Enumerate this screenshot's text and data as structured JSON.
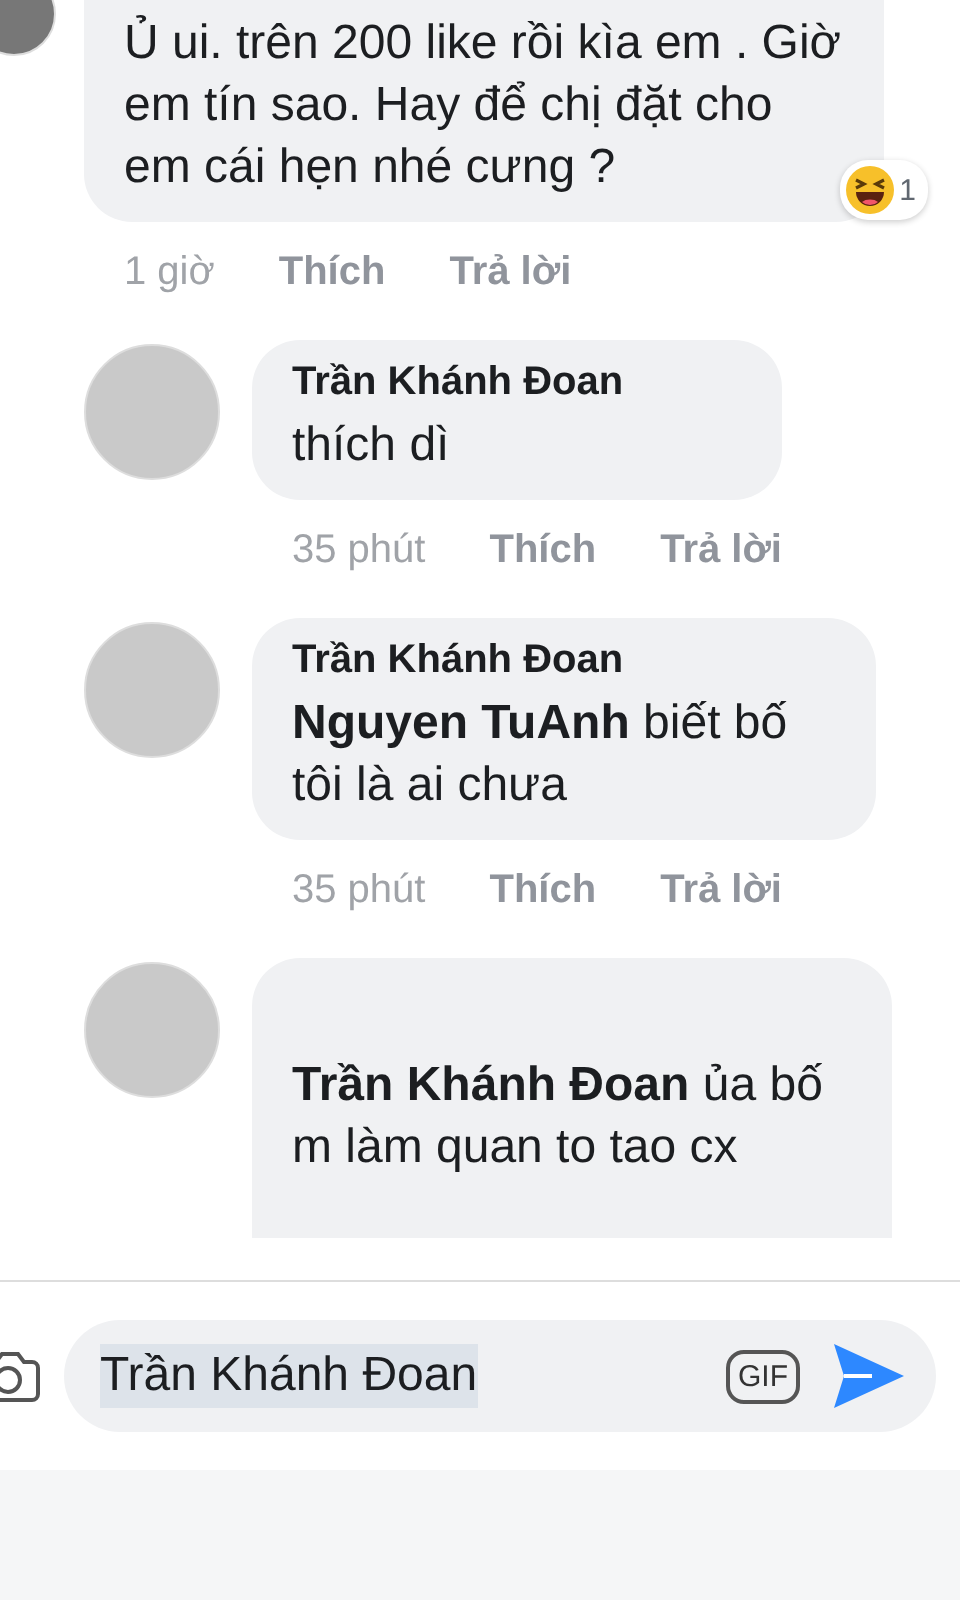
{
  "comments": [
    {
      "avatar_cropped": true,
      "body": "Ủ ui. trên 200 like rồi kìa em . Giờ em tín sao.  Hay để chị đặt cho em cái hẹn nhé cưng ?",
      "time": "1 giờ",
      "like": "Thích",
      "reply": "Trả lời",
      "reaction": {
        "count": "1"
      }
    },
    {
      "avatar_cropped": false,
      "author": "Trần Khánh Đoan",
      "body": "thích dì",
      "time": "35 phút",
      "like": "Thích",
      "reply": "Trả lời"
    },
    {
      "avatar_cropped": false,
      "author": "Trần Khánh Đoan",
      "body": "**Nguyen TuAnh**  biết bố tôi là ai chưa",
      "time": "35 phút",
      "like": "Thích",
      "reply": "Trả lời"
    },
    {
      "avatar_cropped": false,
      "body": "**Trần Khánh Đoan** ủa bố m làm quan to tao cx"
    }
  ],
  "composer": {
    "value": "Trần Khánh Đoan",
    "gif": "GIF"
  }
}
